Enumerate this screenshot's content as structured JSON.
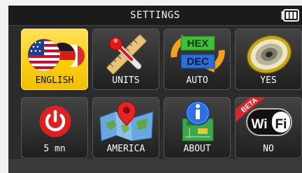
{
  "header": {
    "title": "SETTINGS",
    "battery_icon": "battery-icon"
  },
  "tiles": [
    {
      "label": "ENGLISH",
      "icon": "language-flags-icon",
      "selected": true
    },
    {
      "label": "UNITS",
      "icon": "ruler-thermometer-icon",
      "selected": false
    },
    {
      "label": "AUTO",
      "icon": "hex-dec-icon",
      "selected": false
    },
    {
      "label": "YES",
      "icon": "speaker-icon",
      "selected": false
    },
    {
      "label": "5 mn",
      "icon": "power-icon",
      "selected": false
    },
    {
      "label": "AMERICA",
      "icon": "map-pin-icon",
      "selected": false
    },
    {
      "label": "ABOUT",
      "icon": "info-icon",
      "selected": false
    },
    {
      "label": "NO",
      "icon": "wifi-icon",
      "badge": "BETA",
      "selected": false
    }
  ],
  "icon_text": {
    "hex": "HEX",
    "dec": "DEC",
    "wifi_left": "Wi",
    "wifi_right": "Fi"
  },
  "colors": {
    "selected_tile": "#ffd21a",
    "power_red": "#e02020",
    "wifi_badge": "#d8262b"
  }
}
